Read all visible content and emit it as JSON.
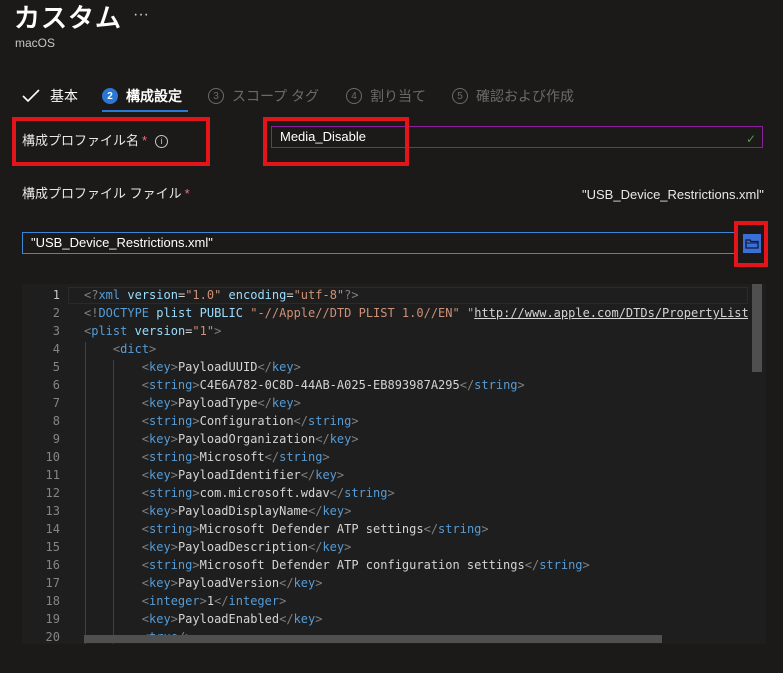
{
  "header": {
    "title": "カスタム",
    "more_label": "···",
    "subtitle": "macOS"
  },
  "steps": [
    {
      "number": "",
      "label": "基本",
      "state": "done"
    },
    {
      "number": "2",
      "label": "構成設定",
      "state": "active"
    },
    {
      "number": "3",
      "label": "スコープ タグ",
      "state": "disabled"
    },
    {
      "number": "4",
      "label": "割り当て",
      "state": "disabled"
    },
    {
      "number": "5",
      "label": "確認および作成",
      "state": "disabled"
    }
  ],
  "form": {
    "profile_name_label": "構成プロファイル名",
    "required_mark": "*",
    "info_icon": "i",
    "profile_name_value": "Media_Disable",
    "profile_file_label": "構成プロファイル ファイル",
    "selected_file_name": "\"USB_Device_Restrictions.xml\"",
    "file_input_value": "\"USB_Device_Restrictions.xml\""
  },
  "editor": {
    "line_numbers": [
      "1",
      "2",
      "3",
      "4",
      "5",
      "6",
      "7",
      "8",
      "9",
      "10",
      "11",
      "12",
      "13",
      "14",
      "15",
      "16",
      "17",
      "18",
      "19",
      "20"
    ],
    "current_line": 1
  },
  "colors": {
    "accent": "#2b78d4",
    "highlight_red": "#e3151b",
    "input_border": "#8a1e9e",
    "file_border": "#3b87d6"
  }
}
